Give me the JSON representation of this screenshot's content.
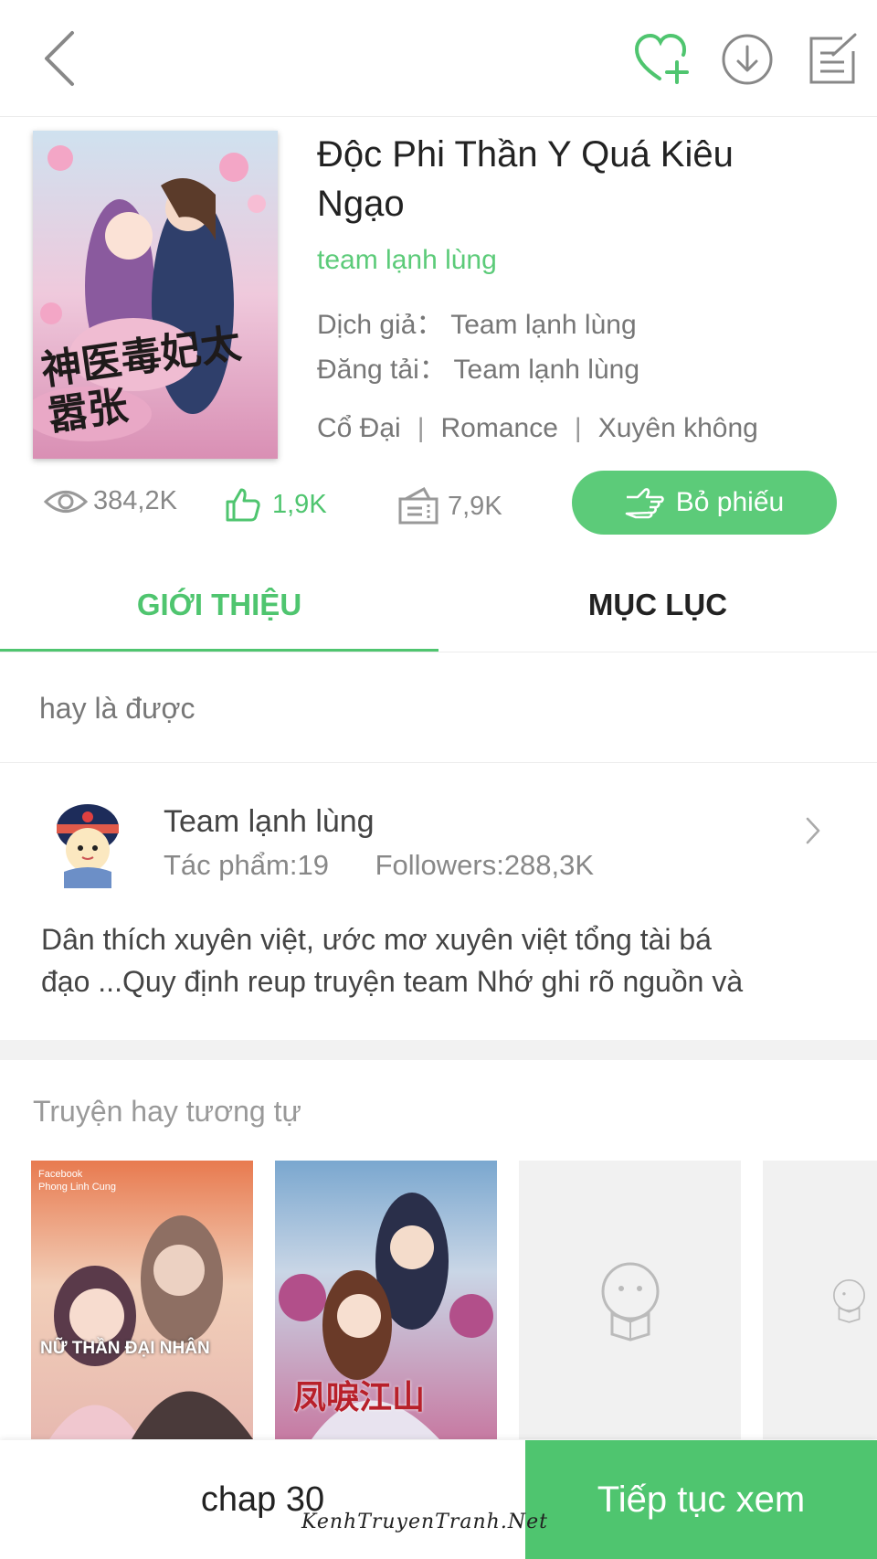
{
  "book": {
    "title": "Độc Phi Thần Y Quá Kiêu Ngạo",
    "team": "team lạnh lùng",
    "translator_label": "Dịch giả：",
    "translator": "Team lạnh lùng",
    "uploader_label": "Đăng tải：",
    "uploader": "Team lạnh lùng",
    "tags": [
      "Cổ Đại",
      "Romance",
      "Xuyên không"
    ],
    "tag_separator": "|",
    "cover_title": "神医毒妃太嚣张"
  },
  "stats": {
    "views": "384,2K",
    "likes": "1,9K",
    "tickets": "7,9K",
    "vote_label": "Bỏ phiếu"
  },
  "tabs": [
    {
      "label": "GIỚI THIỆU",
      "active": true
    },
    {
      "label": "MỤC LỤC",
      "active": false
    }
  ],
  "intro": {
    "text": "hay là được"
  },
  "author": {
    "name": "Team lạnh lùng",
    "works": "Tác phẩm:19",
    "followers": "Followers:288,3K",
    "description_line1": "Dân thích xuyên việt, ước mơ xuyên việt tổng tài bá",
    "description_line2": "đạo ...Quy định reup truyện team  Nhớ ghi rõ nguồn và"
  },
  "similar": {
    "title": "Truyện hay tương tự",
    "items": [
      {
        "overlay_top1": "Facebook",
        "overlay_top2": "Phong Linh Cung",
        "overlay_title": "NỮ THẦN ĐẠI NHÂN"
      },
      {
        "overlay_title": "凤唳江山"
      },
      {
        "placeholder": true
      },
      {
        "placeholder": true
      }
    ]
  },
  "bottom": {
    "chapter": "chap 30",
    "continue_label": "Tiếp tục xem",
    "watermark": "KenhTruyenTranh.Net"
  },
  "colors": {
    "accent": "#4fc56f",
    "accent_light": "#5ccb79"
  },
  "icons": [
    "back-chevron-icon",
    "heart-plus-icon",
    "download-icon",
    "edit-icon",
    "eye-icon",
    "thumbs-up-icon",
    "ticket-icon",
    "hand-pointer-icon",
    "chevron-right-icon"
  ]
}
